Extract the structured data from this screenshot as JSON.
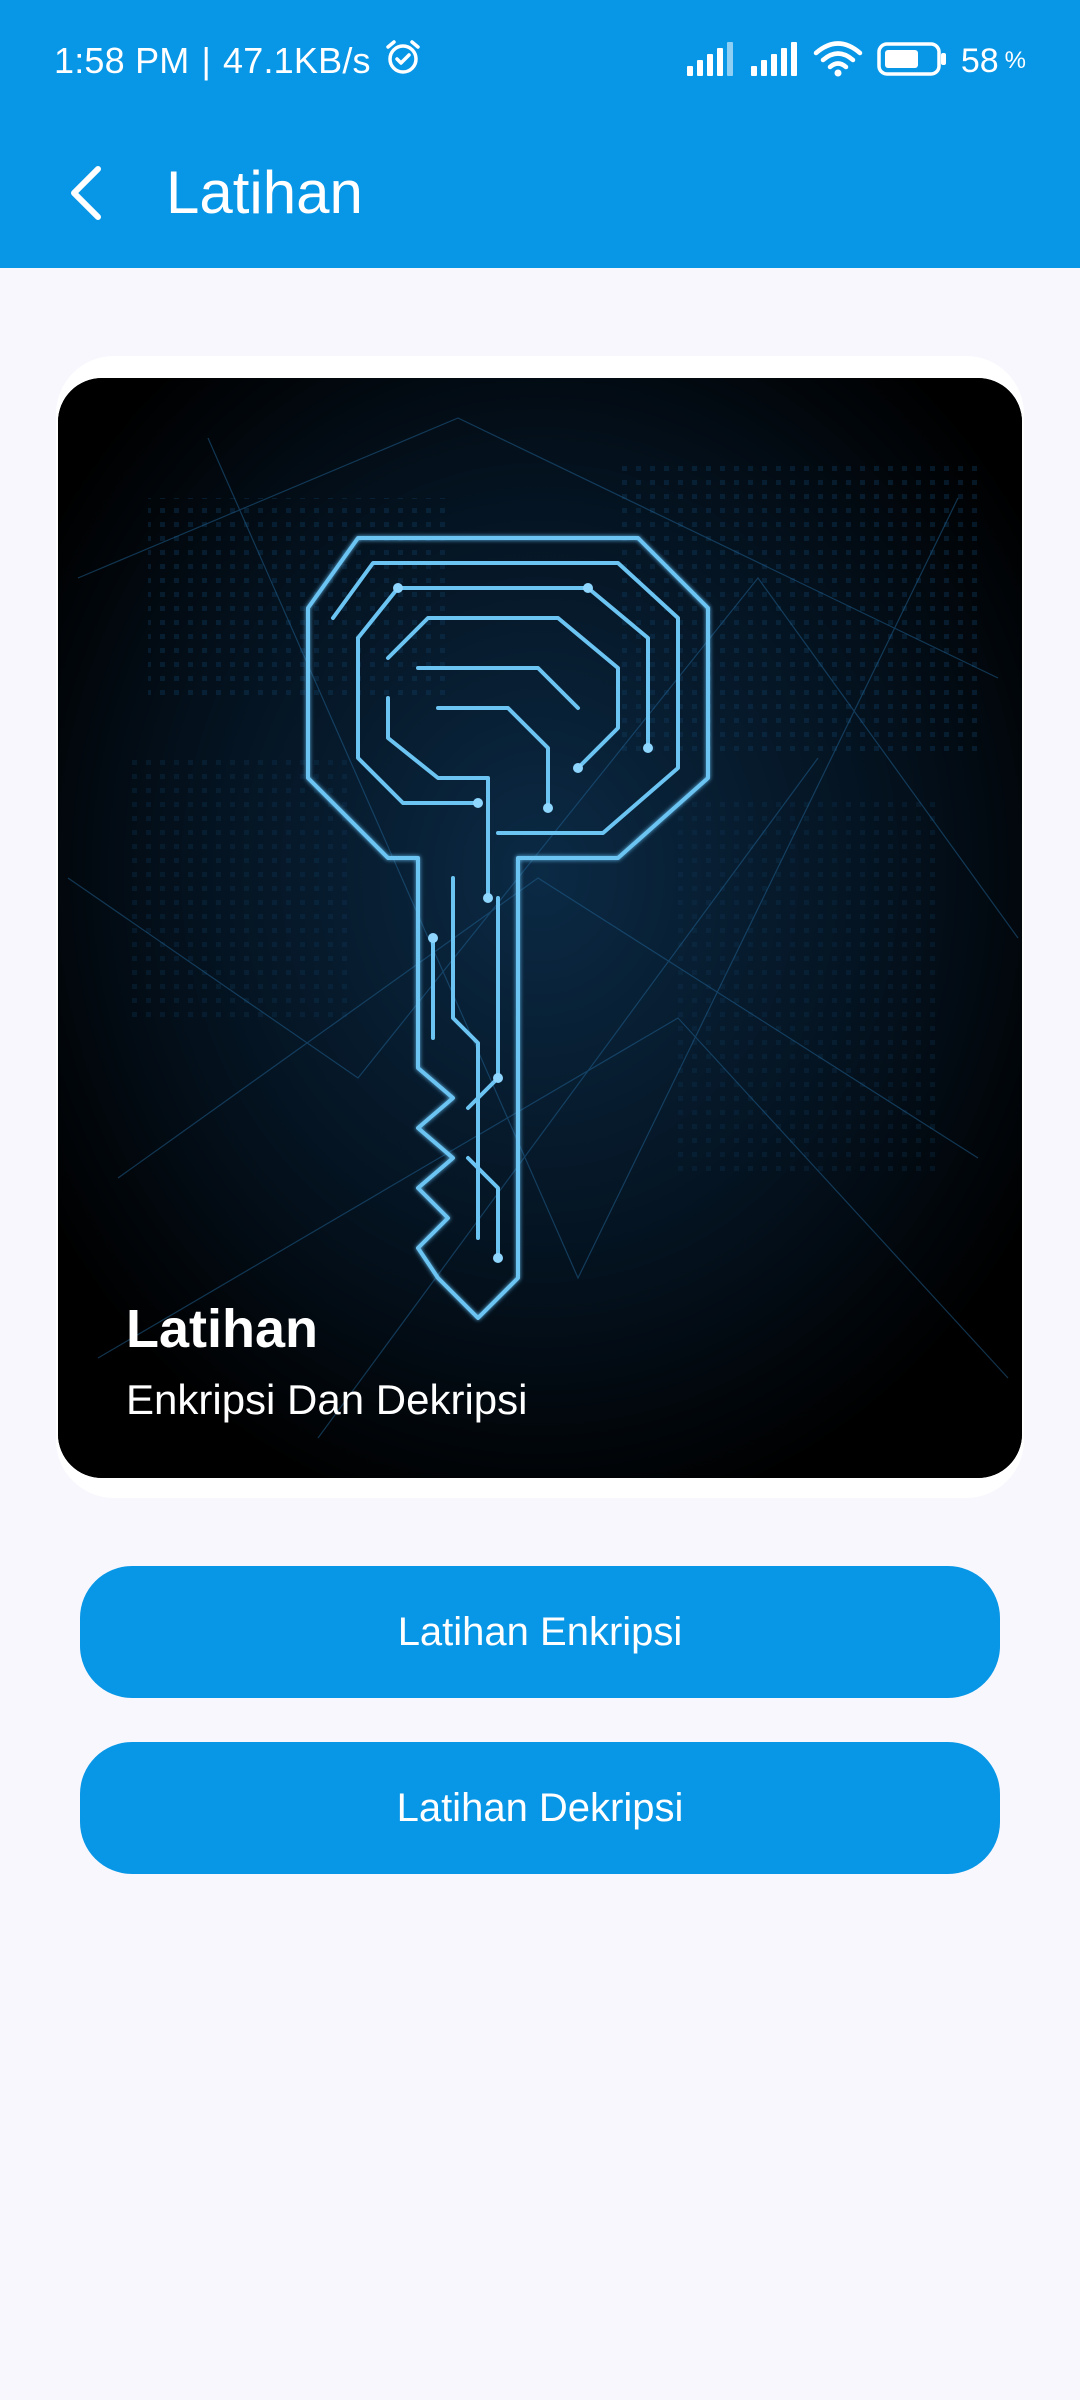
{
  "status_bar": {
    "time": "1:58 PM",
    "separator": "|",
    "network_speed": "47.1KB/s",
    "alarm_icon": "alarm-icon",
    "signal_icon": "signal-icon",
    "wifi_icon": "wifi-icon",
    "battery_icon": "battery-icon",
    "battery_level": "58",
    "battery_unit": "%"
  },
  "app_bar": {
    "title": "Latihan",
    "back_icon": "back-arrow-icon"
  },
  "card": {
    "title": "Latihan",
    "subtitle": "Enkripsi Dan Dekripsi",
    "image": "circuit-key-image"
  },
  "buttons": {
    "enkripsi_label": "Latihan Enkripsi",
    "dekripsi_label": "Latihan Dekripsi"
  },
  "colors": {
    "primary": "#0896e6",
    "background": "#f7f7fd",
    "card_text": "#ffffff"
  }
}
